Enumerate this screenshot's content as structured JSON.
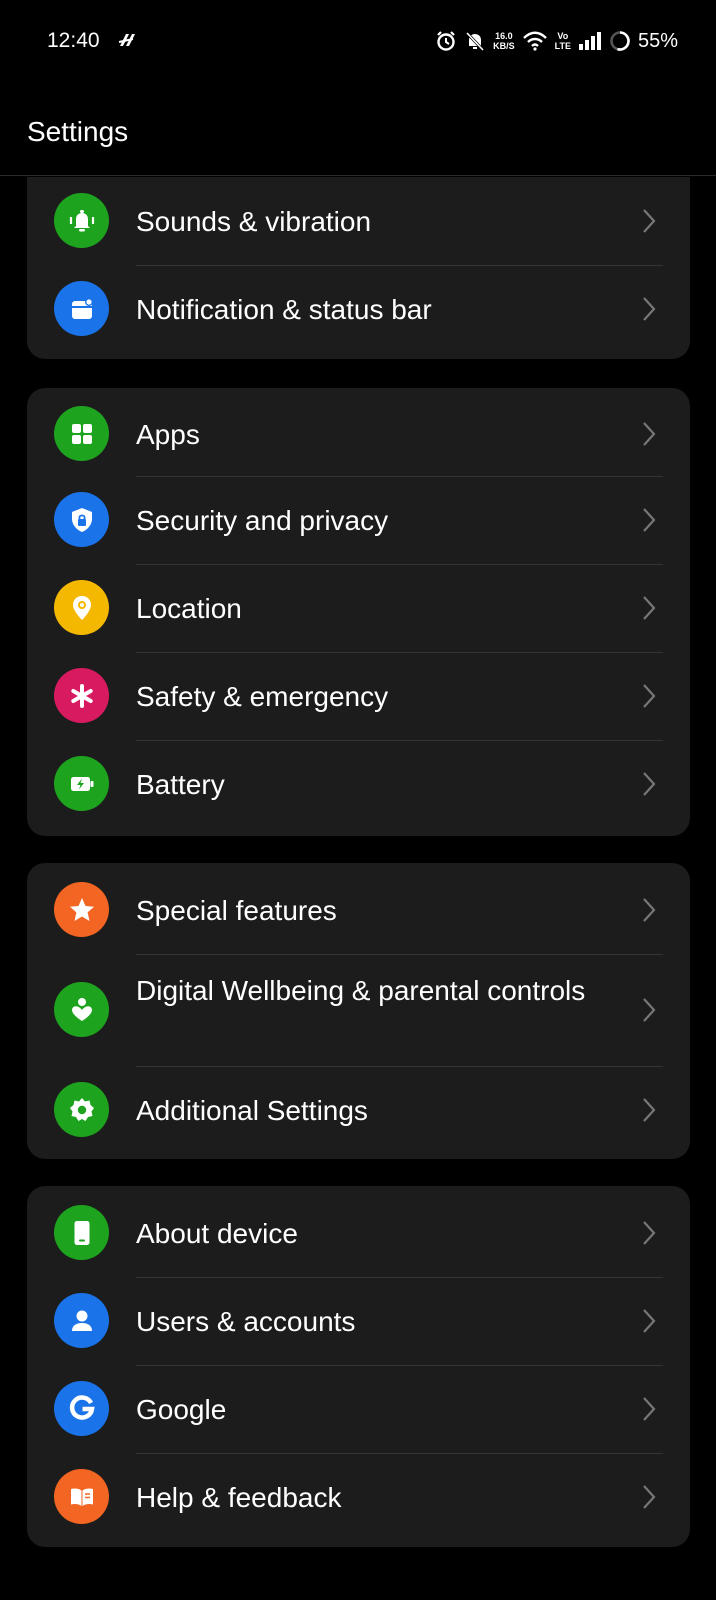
{
  "status_bar": {
    "time": "12:40",
    "net_speed_value": "16.0",
    "net_speed_unit": "KB/S",
    "volte_top": "Vo",
    "volte_bottom": "LTE",
    "battery_percent": "55%"
  },
  "header": {
    "title": "Settings"
  },
  "groups": [
    {
      "items": [
        {
          "label": "Sounds & vibration",
          "icon": "bell-icon",
          "color": "#1ea31e"
        },
        {
          "label": "Notification & status bar",
          "icon": "notification-icon",
          "color": "#1a73e8"
        }
      ]
    },
    {
      "items": [
        {
          "label": "Apps",
          "icon": "apps-grid-icon",
          "color": "#1ea31e"
        },
        {
          "label": "Security and privacy",
          "icon": "shield-lock-icon",
          "color": "#1a73e8"
        },
        {
          "label": "Location",
          "icon": "location-pin-icon",
          "color": "#f5b800"
        },
        {
          "label": "Safety & emergency",
          "icon": "asterisk-icon",
          "color": "#d81b60"
        },
        {
          "label": "Battery",
          "icon": "battery-charging-icon",
          "color": "#1ea31e"
        }
      ]
    },
    {
      "items": [
        {
          "label": "Special features",
          "icon": "star-icon",
          "color": "#f26522"
        },
        {
          "label": "Digital Wellbeing & parental controls",
          "icon": "wellbeing-heart-icon",
          "color": "#1ea31e"
        },
        {
          "label": "Additional Settings",
          "icon": "gear-icon",
          "color": "#1ea31e"
        }
      ]
    },
    {
      "items": [
        {
          "label": "About device",
          "icon": "phone-device-icon",
          "color": "#1ea31e"
        },
        {
          "label": "Users & accounts",
          "icon": "user-icon",
          "color": "#1a73e8"
        },
        {
          "label": "Google",
          "icon": "google-g-icon",
          "color": "#1a73e8"
        },
        {
          "label": "Help & feedback",
          "icon": "help-book-icon",
          "color": "#f26522"
        }
      ]
    }
  ]
}
